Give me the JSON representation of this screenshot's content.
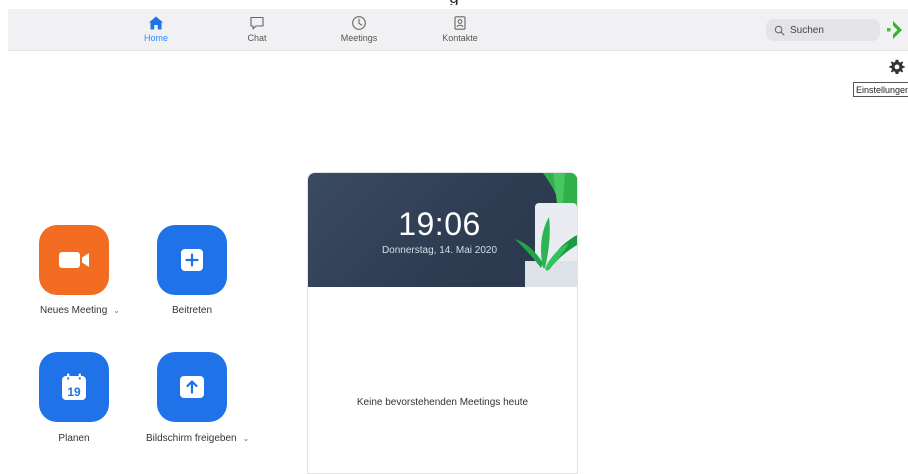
{
  "window": {
    "title_partial": "g"
  },
  "nav": {
    "tabs": [
      {
        "label": "Home",
        "icon": "home-icon",
        "active": true
      },
      {
        "label": "Chat",
        "icon": "chat-icon",
        "active": false
      },
      {
        "label": "Meetings",
        "icon": "clock-icon",
        "active": false
      },
      {
        "label": "Kontakte",
        "icon": "contacts-icon",
        "active": false
      }
    ],
    "accent_color": "#2d8cff"
  },
  "search": {
    "placeholder": "Suchen",
    "icon": "search-icon"
  },
  "settings": {
    "icon": "gear-icon",
    "tooltip": "Einstellungen"
  },
  "actions": {
    "new_meeting": {
      "label": "Neues Meeting",
      "icon": "video-camera-icon",
      "color": "#f26d21"
    },
    "join": {
      "label": "Beitreten",
      "icon": "plus-icon",
      "color": "#1f72e8"
    },
    "schedule": {
      "label": "Planen",
      "icon": "calendar-icon",
      "calendar_day": "19",
      "color": "#1f72e8"
    },
    "share_screen": {
      "label": "Bildschirm freigeben",
      "icon": "share-up-arrow-icon",
      "color": "#1f72e8"
    }
  },
  "meeting_card": {
    "time": "19:06",
    "date": "Donnerstag, 14. Mai 2020",
    "empty_message": "Keine bevorstehenden Meetings heute"
  }
}
